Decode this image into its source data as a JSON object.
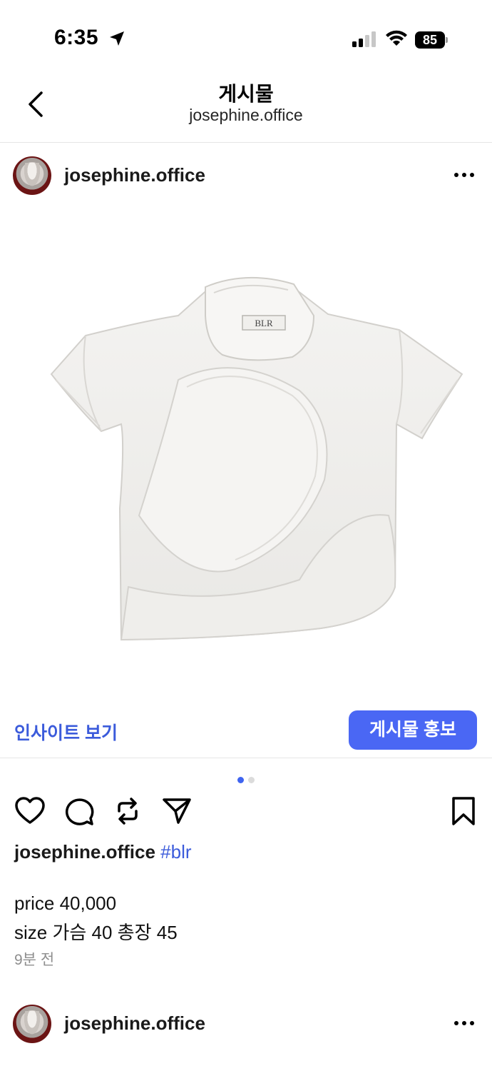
{
  "status": {
    "time": "6:35",
    "battery": "85"
  },
  "nav": {
    "title": "게시물",
    "subtitle": "josephine.office"
  },
  "post": {
    "username": "josephine.office",
    "image": {
      "label": "BLR"
    },
    "insight_label": "인사이트 보기",
    "promote_label": "게시물 홍보",
    "caption": {
      "username": "josephine.office",
      "hashtag": "#blr"
    },
    "description": [
      "price 40,000",
      "size 가슴 40 총장 45"
    ],
    "time_ago": "9분 전"
  },
  "next_post": {
    "username": "josephine.office"
  },
  "colors": {
    "accent": "#4a67f4",
    "link": "#3b5bdb"
  }
}
